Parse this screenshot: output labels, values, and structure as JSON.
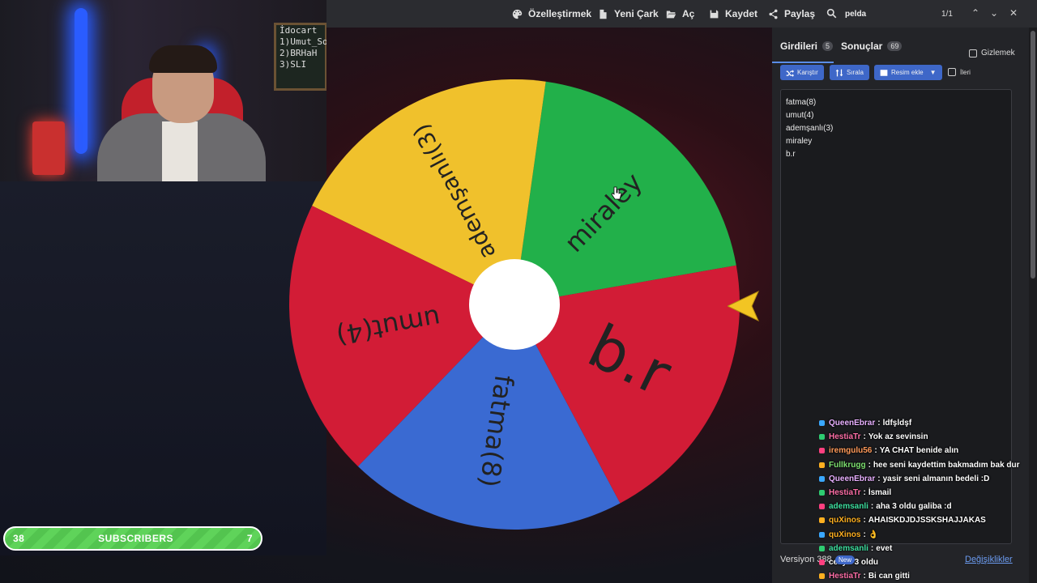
{
  "toolbar": {
    "customize": "Özelleştirmek",
    "new_wheel": "Yeni Çark",
    "open": "Aç",
    "save": "Kaydet",
    "share": "Paylaş",
    "search_query": "pelda",
    "search_count": "1/1"
  },
  "webcam": {
    "board_lines": [
      "İdocart",
      "1)Umut_So",
      "2)BRHaH",
      "3)SLI"
    ]
  },
  "wheel": {
    "segments": [
      {
        "label": "miraley",
        "color": "#22b04a"
      },
      {
        "label": "ademşanlı(3)",
        "color": "#f0c12c"
      },
      {
        "label": "umut(4)",
        "color": "#d21c36"
      },
      {
        "label": "fatma(8)",
        "color": "#3a6ad2"
      },
      {
        "label": "b.r",
        "color": "#d21c36"
      }
    ]
  },
  "subscribers": {
    "left_count": "38",
    "label": "SUBSCRIBERS",
    "right_count": "7"
  },
  "panel": {
    "tab_entries": "Girdileri",
    "tab_entries_count": "5",
    "tab_results": "Sonuçlar",
    "tab_results_count": "69",
    "hide_label": "Gizlemek",
    "shuffle": "Karıştır",
    "sort": "Sırala",
    "add_image": "Resim ekle",
    "advanced": "İleri",
    "entries": [
      "fatma(8)",
      "umut(4)",
      "ademşanlı(3)",
      "miraley",
      "b.r"
    ],
    "version": "Versiyon 388",
    "changes": "Değişiklikler"
  },
  "chat": {
    "new_badge": "New",
    "messages": [
      {
        "user": "QueenEbrar",
        "text": "ldfşldşf",
        "color": "#e8b0ff"
      },
      {
        "user": "HestiaTr",
        "text": "Yok az sevinsin",
        "color": "#ff6fa8"
      },
      {
        "user": "iremgulu56",
        "text": "YA CHAT benide alın",
        "color": "#ff9a5a"
      },
      {
        "user": "Fullkrugg",
        "text": "hee seni kaydettim bakmadım bak dur",
        "color": "#7de070"
      },
      {
        "user": "QueenEbrar",
        "text": "yasir seni almanın bedeli :D",
        "color": "#e8b0ff"
      },
      {
        "user": "HestiaTr",
        "text": "İsmail",
        "color": "#ff6fa8"
      },
      {
        "user": "ademsanli",
        "text": "aha 3 oldu galiba :d",
        "color": "#3ee0a0"
      },
      {
        "user": "quXinos",
        "text": "AHAISKDJDJSSKSHAJJAKAS",
        "color": "#ffb020"
      },
      {
        "user": "quXinos",
        "text": "👌",
        "color": "#ffb020"
      },
      {
        "user": "ademsanli",
        "text": "evet",
        "color": "#3ee0a0"
      },
      {
        "user": "cesy",
        "text": "3 oldu",
        "color": "#ffffff"
      },
      {
        "user": "HestiaTr",
        "text": "Bi can gitti",
        "color": "#ff6fa8"
      }
    ]
  }
}
